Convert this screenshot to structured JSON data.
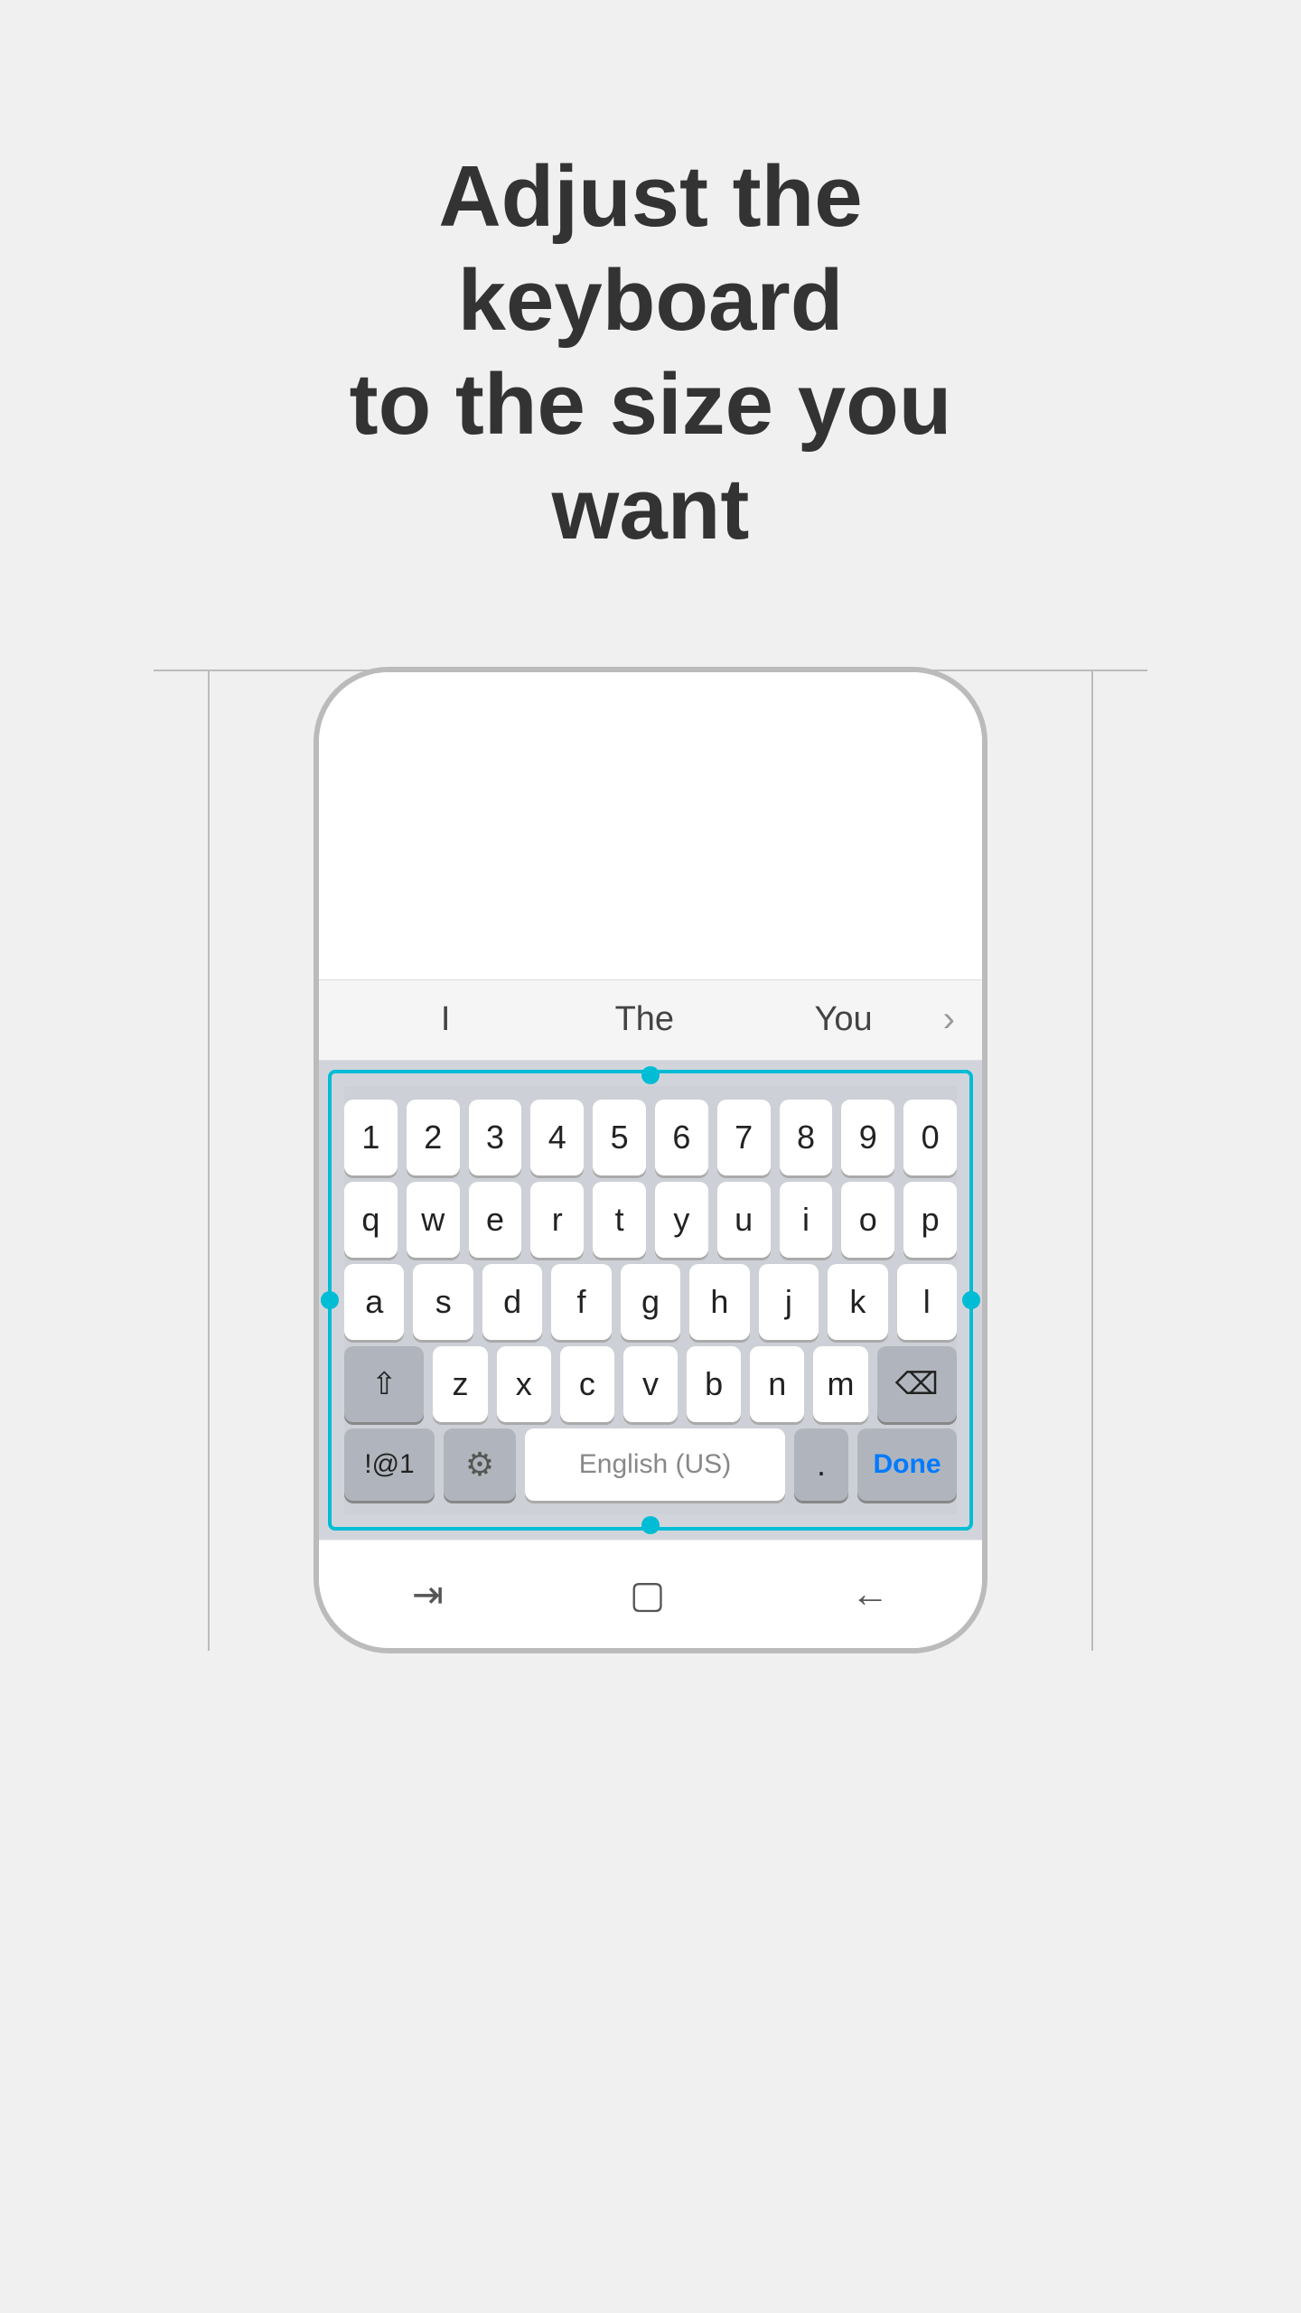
{
  "title": {
    "line1": "Adjust the keyboard",
    "line2": "to the size you want"
  },
  "autocomplete": {
    "item1": "I",
    "item2": "The",
    "item3": "You",
    "arrow": "›"
  },
  "keyboard": {
    "row1": [
      "1",
      "2",
      "3",
      "4",
      "5",
      "6",
      "7",
      "8",
      "9",
      "0"
    ],
    "row2": [
      "q",
      "w",
      "e",
      "r",
      "t",
      "y",
      "u",
      "i",
      "o",
      "p"
    ],
    "row3": [
      "a",
      "s",
      "d",
      "f",
      "g",
      "h",
      "j",
      "k",
      "l"
    ],
    "row4": [
      "z",
      "x",
      "c",
      "v",
      "b",
      "n",
      "m"
    ],
    "shift_icon": "⇧",
    "delete_icon": "⌫",
    "symbols_label": "!@1",
    "settings_icon": "⚙",
    "space_label": "English (US)",
    "period_label": ".",
    "done_label": "Done"
  },
  "nav": {
    "recent_icon": "⇥",
    "home_icon": "▢",
    "back_icon": "←"
  }
}
